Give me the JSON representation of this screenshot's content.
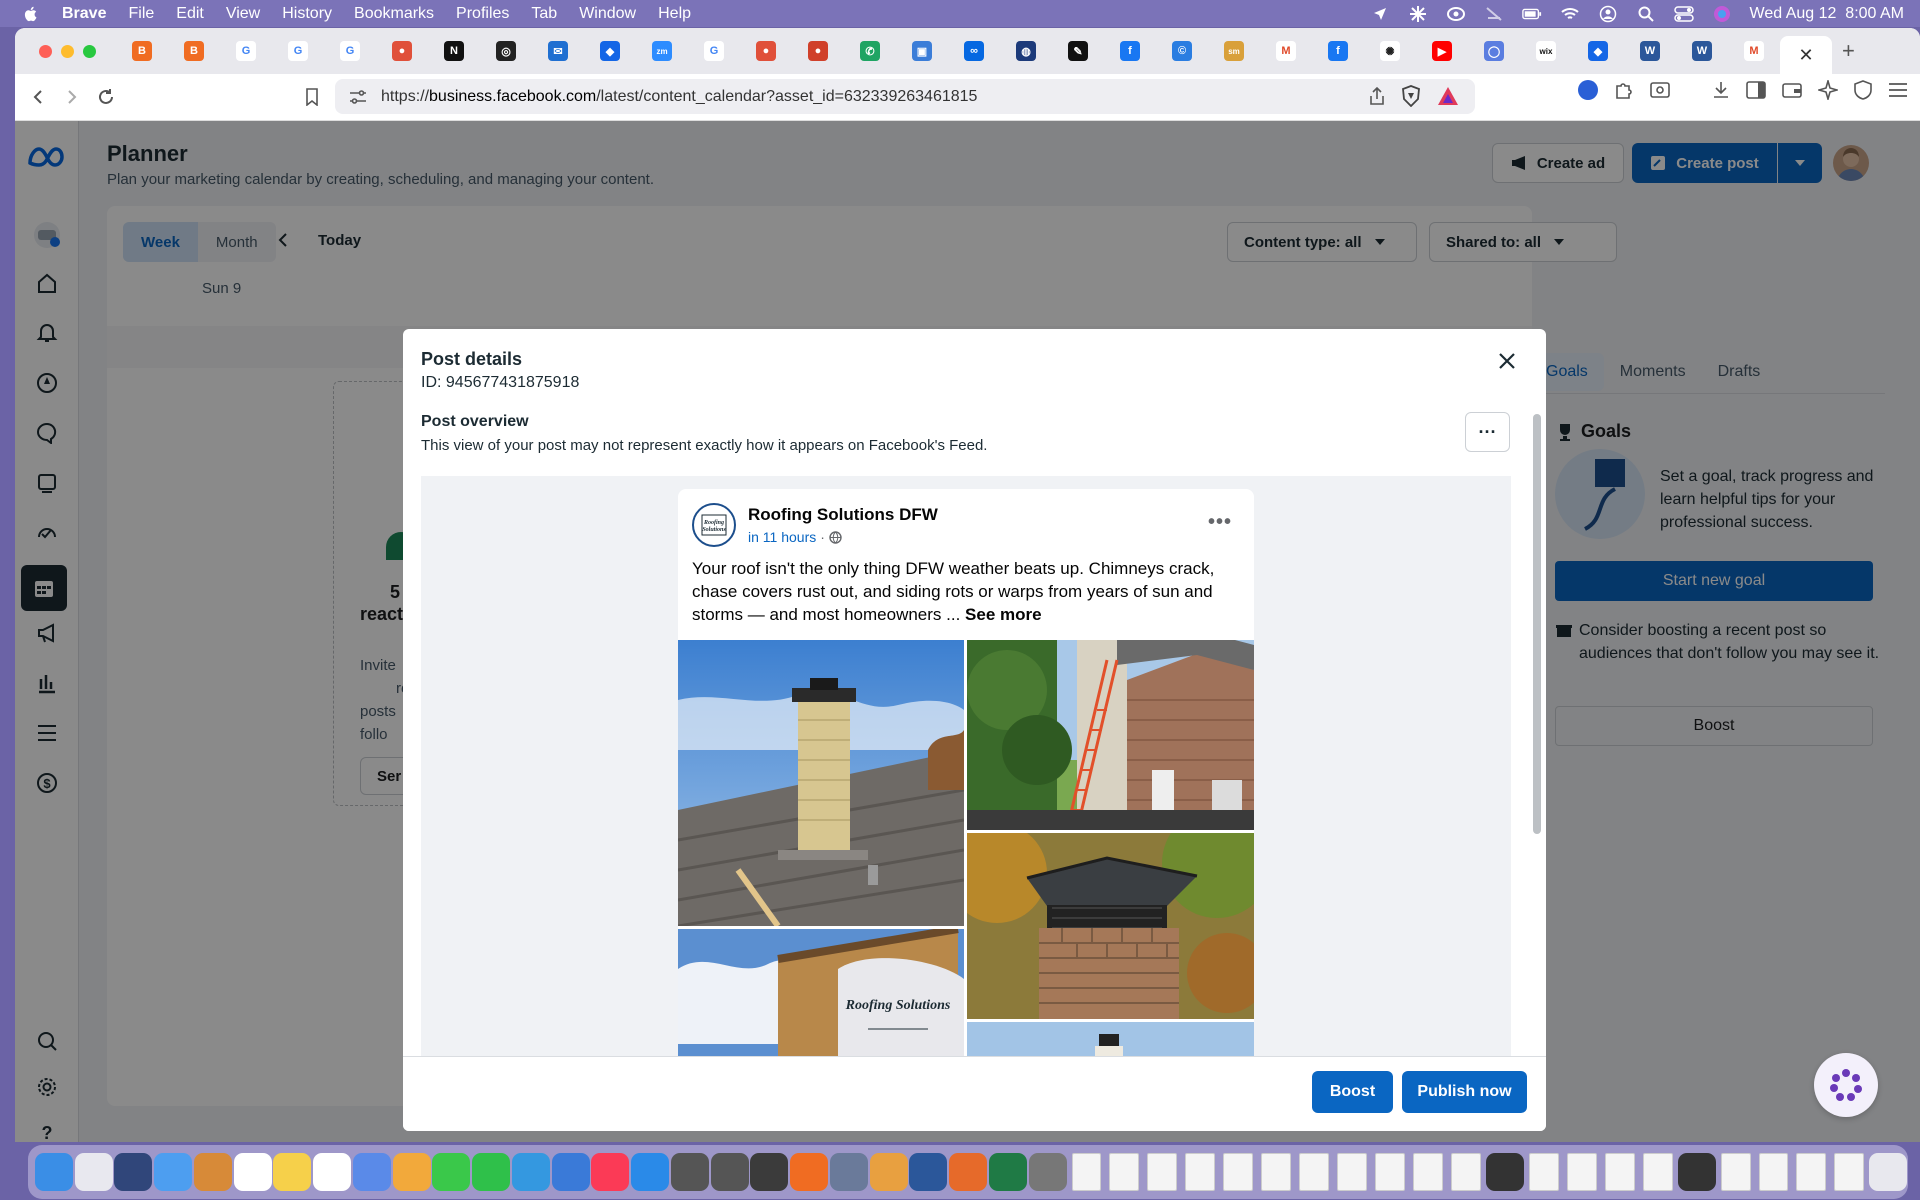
{
  "menubar": {
    "app": "Brave",
    "items": [
      "File",
      "Edit",
      "View",
      "History",
      "Bookmarks",
      "Profiles",
      "Tab",
      "Window",
      "Help"
    ],
    "clock": "Wed Aug 12  8:00 AM"
  },
  "browser": {
    "url_prefix": "https://",
    "url_host": "business.facebook.com",
    "url_path": "/latest/content_calendar?asset_id=632339263461815",
    "tab_favicons": [
      {
        "name": "brave-tab",
        "color": "#f06c22",
        "glyph": "B"
      },
      {
        "name": "brave-tab",
        "color": "#f06c22",
        "glyph": "B"
      },
      {
        "name": "google-tab",
        "color": "#ffffff",
        "glyph": "G"
      },
      {
        "name": "google-tab",
        "color": "#ffffff",
        "glyph": "G"
      },
      {
        "name": "google-tab",
        "color": "#ffffff",
        "glyph": "G"
      },
      {
        "name": "app-tab",
        "color": "#e0503a",
        "glyph": "●"
      },
      {
        "name": "notion-tab",
        "color": "#111111",
        "glyph": "N"
      },
      {
        "name": "app-tab",
        "color": "#222222",
        "glyph": "◎"
      },
      {
        "name": "outlook-tab",
        "color": "#1f6fd1",
        "glyph": "✉"
      },
      {
        "name": "dropbox-tab",
        "color": "#1466e6",
        "glyph": "◆"
      },
      {
        "name": "zoom-tab",
        "color": "#2d8cff",
        "glyph": "zm"
      },
      {
        "name": "google-tab",
        "color": "#ffffff",
        "glyph": "G"
      },
      {
        "name": "app-tab",
        "color": "#e0503a",
        "glyph": "●"
      },
      {
        "name": "app-tab",
        "color": "#d0402a",
        "glyph": "●"
      },
      {
        "name": "phone-tab",
        "color": "#1fa463",
        "glyph": "✆"
      },
      {
        "name": "photo-tab",
        "color": "#3b7dd8",
        "glyph": "▣"
      },
      {
        "name": "meta-tab",
        "color": "#0668e1",
        "glyph": "∞"
      },
      {
        "name": "app-tab",
        "color": "#1c3a7a",
        "glyph": "◍"
      },
      {
        "name": "app-tab",
        "color": "#111111",
        "glyph": "✎"
      },
      {
        "name": "facebook-tab",
        "color": "#1877f2",
        "glyph": "f"
      },
      {
        "name": "app-tab",
        "color": "#2a7de1",
        "glyph": "©"
      },
      {
        "name": "app-tab",
        "color": "#d9a03a",
        "glyph": "sm"
      },
      {
        "name": "gmail-tab",
        "color": "#ffffff",
        "glyph": "M"
      },
      {
        "name": "facebook-tab",
        "color": "#1877f2",
        "glyph": "f"
      },
      {
        "name": "openai-tab",
        "color": "#ffffff",
        "glyph": "✺"
      },
      {
        "name": "youtube-tab",
        "color": "#ff0000",
        "glyph": "▶"
      },
      {
        "name": "app-tab",
        "color": "#5a7de0",
        "glyph": "◯"
      },
      {
        "name": "wix-tab",
        "color": "#ffffff",
        "glyph": "wix"
      },
      {
        "name": "dropbox-tab",
        "color": "#1466e6",
        "glyph": "◆"
      },
      {
        "name": "word-tab",
        "color": "#2b579a",
        "glyph": "W"
      },
      {
        "name": "word-tab",
        "color": "#2b579a",
        "glyph": "W"
      },
      {
        "name": "gmail-tab",
        "color": "#ffffff",
        "glyph": "M"
      }
    ]
  },
  "planner": {
    "title": "Planner",
    "subtitle": "Plan your marketing calendar by creating, scheduling, and managing your content.",
    "create_ad": "Create ad",
    "create_post": "Create post",
    "view_week": "Week",
    "view_month": "Month",
    "today": "Today",
    "day_label": "Sun 9",
    "content_type_filter": "Content type: all",
    "shared_filter": "Shared to: all",
    "right_tabs": [
      "Goals",
      "Moments",
      "Drafts"
    ],
    "goals_title": "Goals",
    "goals_text": "Set a goal, track progress and learn helpful tips for your professional success.",
    "start_goal": "Start new goal",
    "boost_tip": "Consider boosting a recent post so audiences that don't follow you may see it.",
    "boost_label": "Boost",
    "card_partial_count": "5",
    "card_partial_line": "react",
    "card_partial_body": [
      "Invite",
      "react",
      "posts",
      "follo"
    ],
    "card_partial_btn": "Ser"
  },
  "modal": {
    "title": "Post details",
    "id_label": "ID: 945677431875918",
    "overview_title": "Post overview",
    "overview_sub": "This view of your post may not represent exactly how it appears on Facebook's Feed.",
    "more": "···",
    "boost": "Boost",
    "publish": "Publish now"
  },
  "post": {
    "page_name": "Roofing Solutions DFW",
    "schedule": "in 11 hours",
    "separator": "·",
    "text": "Your roof isn't the only thing DFW weather beats up. Chimneys crack, chase covers rust out, and siding rots or warps from years of sun and storms — and most homeowners ... ",
    "see_more": "See more",
    "avatar_text": "Roofing Solutions",
    "shirt_text": "Roofing Solutions"
  },
  "colors": {
    "accent": "#0a66c2",
    "nav_active": "#1c2b33",
    "overlay": "rgba(0,0,0,0.46)"
  }
}
